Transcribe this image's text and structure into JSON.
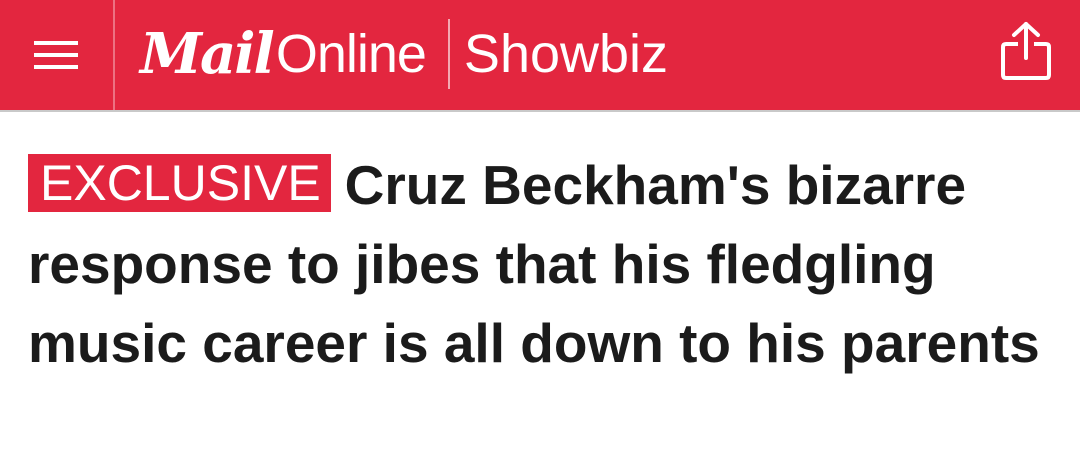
{
  "header": {
    "brand_mail": "Mail",
    "brand_online": "Online",
    "section": "Showbiz",
    "colors": {
      "brand_red": "#e3263f",
      "text_white": "#ffffff"
    },
    "icons": {
      "menu": "hamburger-menu-icon",
      "share": "share-icon"
    }
  },
  "article": {
    "badge": "EXCLUSIVE",
    "headline": "Cruz Beckham's bizarre response to jibes that his fledgling music career is all down to his parents",
    "colors": {
      "badge_bg": "#e3263f",
      "headline_text": "#1b1b1b"
    }
  }
}
